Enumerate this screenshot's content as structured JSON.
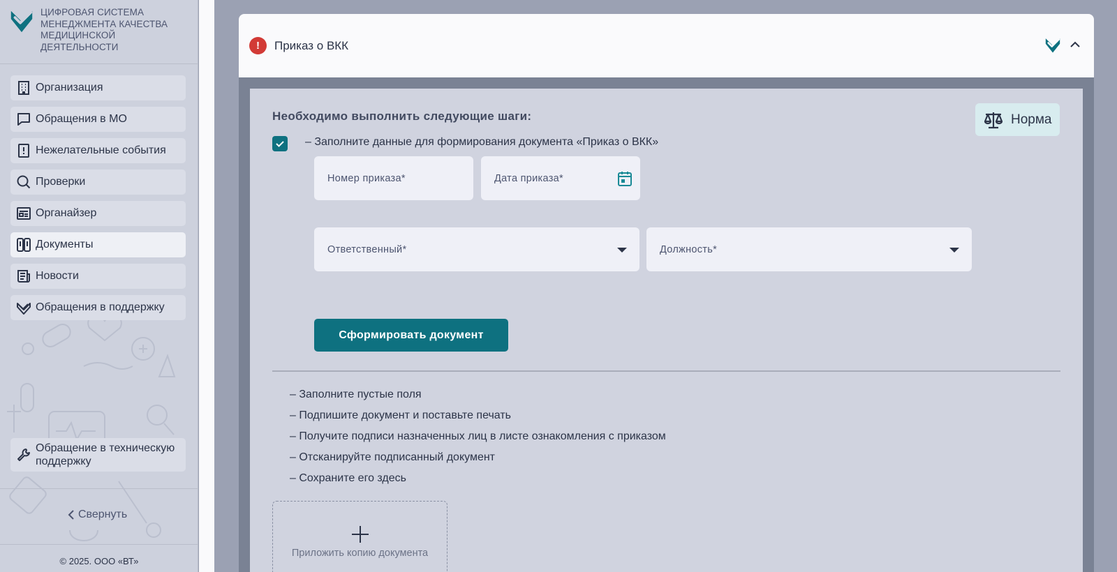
{
  "app": {
    "logo_text": "ЦИФРОВАЯ СИСТЕМА МЕНЕДЖМЕНТА КАЧЕСТВА МЕДИЦИНСКОЙ ДЕЯТЕЛЬНОСТИ",
    "brand_color": "#0e7180"
  },
  "sidebar": {
    "items": [
      {
        "label": "Организация",
        "icon": "building-icon"
      },
      {
        "label": "Обращения в МО",
        "icon": "chat-bubble-icon"
      },
      {
        "label": "Нежелательные события",
        "icon": "alert-book-icon"
      },
      {
        "label": "Проверки",
        "icon": "search-icon"
      },
      {
        "label": "Органайзер",
        "icon": "organizer-icon"
      },
      {
        "label": "Документы",
        "icon": "documents-icon"
      },
      {
        "label": "Новости",
        "icon": "news-icon"
      },
      {
        "label": "Обращения в поддержку",
        "icon": "support-check-icon"
      }
    ],
    "active_item": "Документы",
    "tech_support_label": "Обращение в техническую поддержку",
    "collapse_label": "Свернуть",
    "copyright": "© 2025. ООО «ВТ»"
  },
  "card": {
    "title": "Приказ о ВКК",
    "status_color": "#d23a36",
    "steps_title": "Необходимо выполнить следующие шаги:",
    "norma_label": "Норма",
    "step1_label": "– Заполните данные для формирования документа «Приказ о ВКК»",
    "step1_checked": true,
    "fields": {
      "order_number_placeholder": "Номер приказа*",
      "order_date_placeholder": "Дата приказа*",
      "responsible_placeholder": "Ответственный*",
      "position_placeholder": "Должность*"
    },
    "generate_button": "Сформировать документ",
    "todo": [
      "– Заполните пустые поля",
      "– Подпишите документ и поставьте печать",
      "– Получите подписи назначенных лиц в листе ознакомления с приказом",
      "– Отсканируйте подписанный документ",
      "– Сохраните его здесь"
    ],
    "attach_label": "Приложить копию документа"
  }
}
